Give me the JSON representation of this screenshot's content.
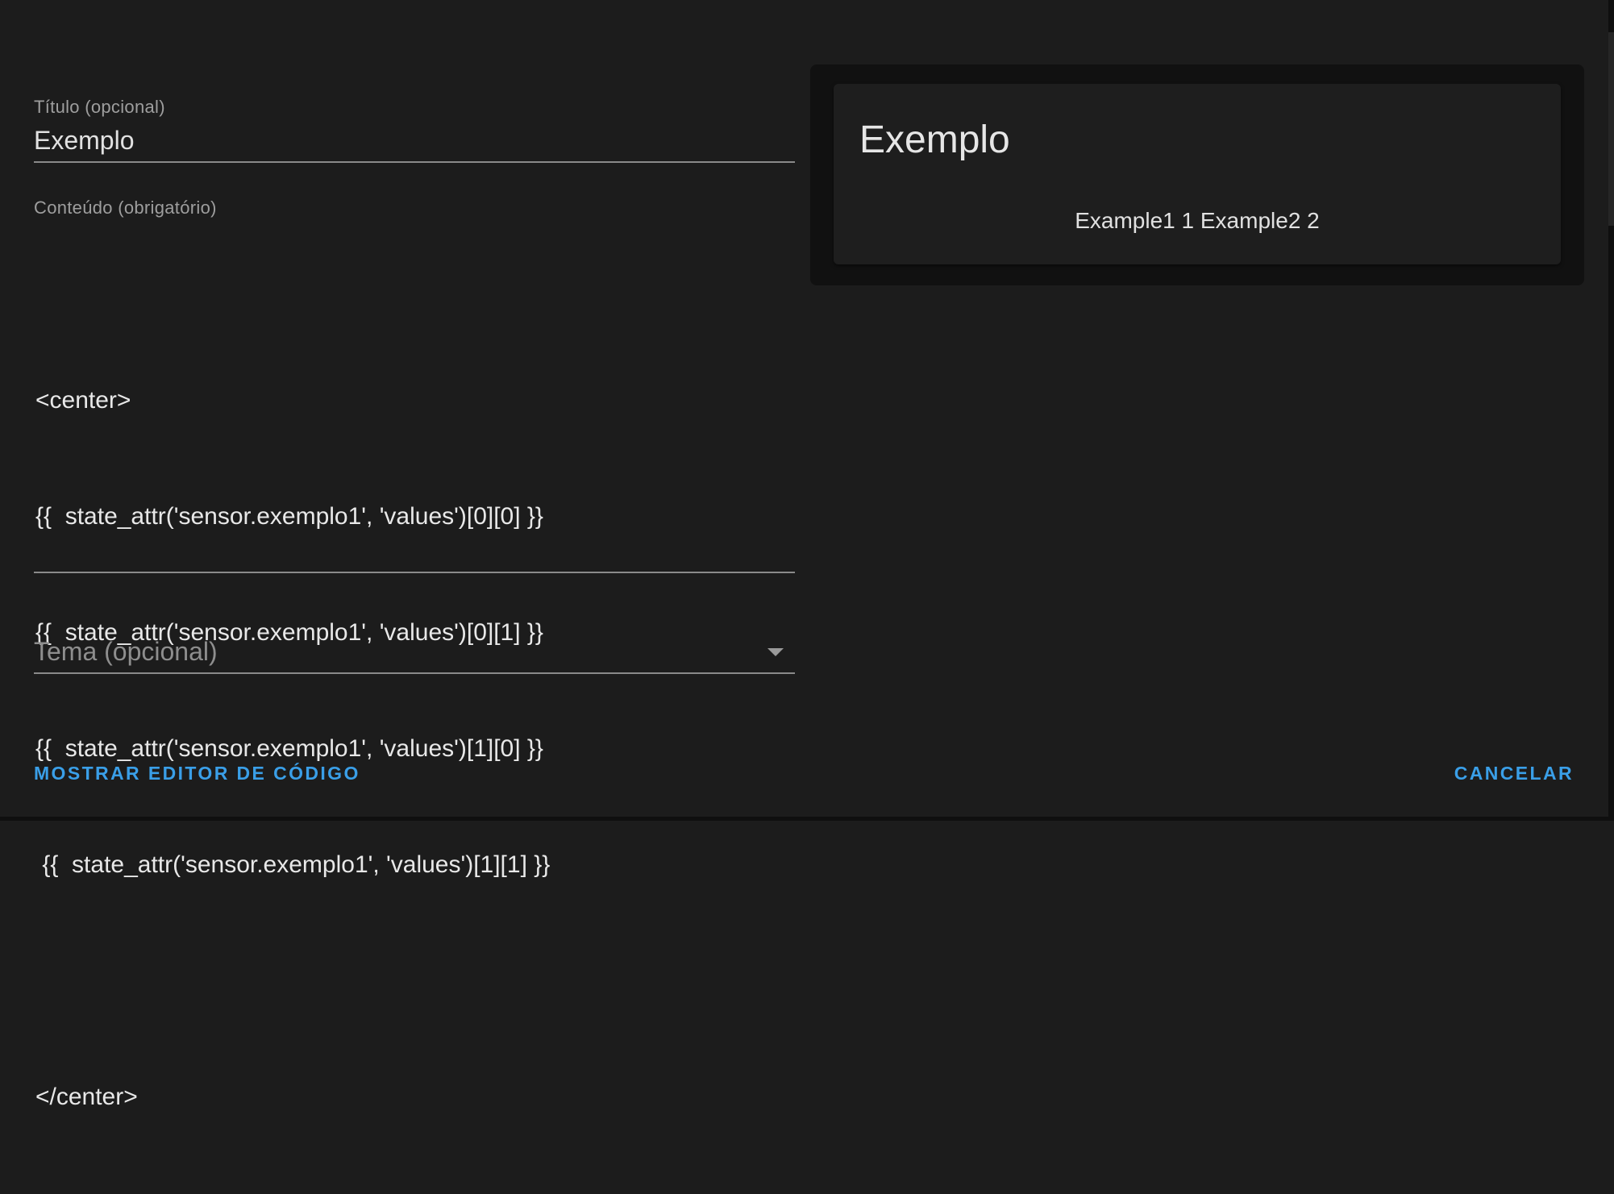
{
  "editor": {
    "title_field": {
      "label": "Título (opcional)",
      "value": "Exemplo"
    },
    "content_field": {
      "label": "Conteúdo (obrigatório)",
      "lines": [
        "<center>",
        "{{  state_attr('sensor.exemplo1', 'values')[0][0] }}",
        "{{  state_attr('sensor.exemplo1', 'values')[0][1] }}",
        "{{  state_attr('sensor.exemplo1', 'values')[1][0] }}",
        " {{  state_attr('sensor.exemplo1', 'values')[1][1] }}",
        "",
        "</center>"
      ]
    },
    "theme_field": {
      "placeholder": "Tema (opcional)",
      "icon": "chevron-down-icon"
    }
  },
  "preview": {
    "card_title": "Exemplo",
    "card_content": "Example1 1 Example2 2"
  },
  "actions": {
    "show_code_editor": "MOSTRAR EDITOR DE CÓDIGO",
    "cancel": "CANCELAR"
  },
  "colors": {
    "background": "#1c1c1c",
    "accent": "#3a9fe8",
    "preview_background": "#111111",
    "card_background": "#1e1e1e"
  }
}
